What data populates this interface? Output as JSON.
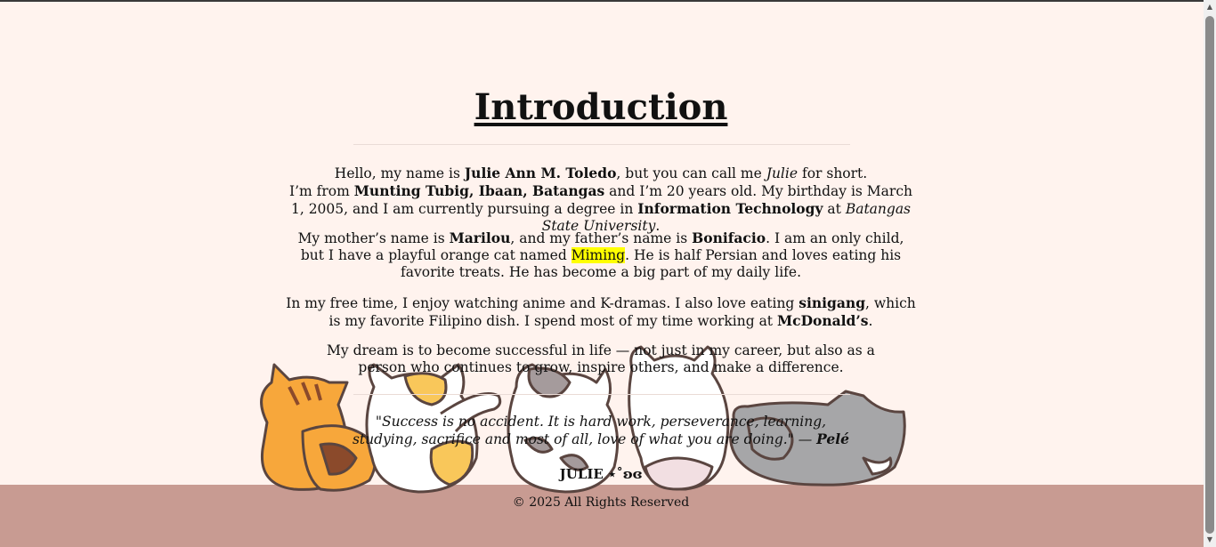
{
  "page": {
    "title": "Introduction",
    "p1_a": "Hello, my name is ",
    "p1_name": "Julie Ann M. Toledo",
    "p1_b": ", but you can call me ",
    "p1_nick": "Julie",
    "p1_c": " for short.",
    "p1_d": "I’m from ",
    "p1_place": "Munting Tubig, Ibaan, Batangas",
    "p1_e": " and I’m 20 years old. My birthday is March 1, 2005, and I am currently pursuing a degree in ",
    "p1_course": "Information Technology",
    "p1_f": " at ",
    "p1_school": "Batangas State University",
    "p1_g": ".",
    "p2_a": "My mother’s name is ",
    "p2_mother": "Marilou",
    "p2_b": ", and my father’s name is ",
    "p2_father": "Bonifacio",
    "p2_c": ". I am an only child, but I have a playful orange cat named ",
    "p2_cat": "Miming",
    "p2_d": ". He is half Persian and loves eating his favorite treats. He has become a big part of my daily life.",
    "p3_a": "In my free time, I enjoy watching anime and K-dramas. I also love eating ",
    "p3_food": "sinigang",
    "p3_b": ", which is my favorite Filipino dish. I spend most of my time working at ",
    "p3_work": "McDonald’s",
    "p3_c": ".",
    "p4": "My dream is to become successful in life — not just in my career, but also as a person who continues to grow, inspire others, and make a difference.",
    "quote_text": "\"Success is no accident. It is hard work, perseverance, learning, studying, sacrifice and most of all, love of what you are doing.\"",
    "quote_dash": " — ",
    "quote_author": "Pelé",
    "signature": "JULIE ⋆˚ʚɞ",
    "copyright": "© 2025 All Rights Reserved"
  },
  "colors": {
    "background": "#fff3ee",
    "floor": "#c89b92",
    "highlight": "#ffff00"
  },
  "icons": {
    "decor": "cats-group-illustration"
  }
}
